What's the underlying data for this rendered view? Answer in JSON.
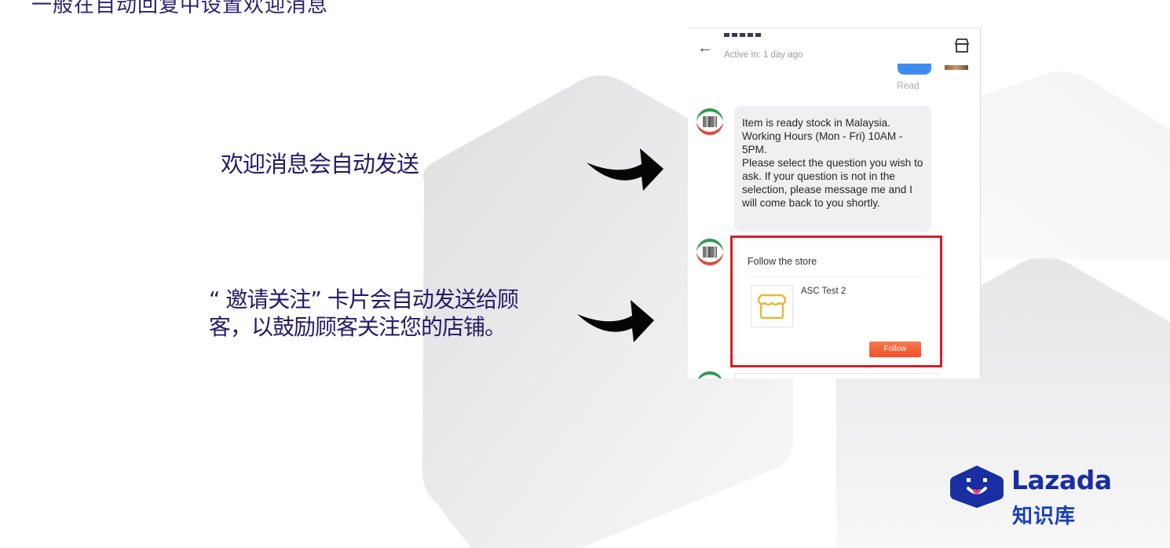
{
  "top_text": "一般在自动回复中设置欢迎消息",
  "captions": {
    "welcome": "欢迎消息会自动发送",
    "invite": "“ 邀请关注” 卡片会自动发送给顾 客，以鼓励顾客关注您的店铺。"
  },
  "phone": {
    "active_status": "Active in: 1 day ago",
    "read_label": "Read",
    "welcome_message": "Item is ready stock in Malaysia.\nWorking Hours (Mon - Fri) 10AM - 5PM.\nPlease select the question you wish to ask. If your question is not in the selection, please message me and I will come back to you shortly.",
    "follow_card": {
      "title": "Follow the store",
      "shop_name": "ASC Test 2",
      "follow_button": "Follow"
    },
    "icons": [
      "back-arrow-icon",
      "store-icon",
      "shop-placeholder-icon"
    ]
  },
  "logo": {
    "brand": "Lazada",
    "subtitle": "知识库",
    "colors": {
      "primary": "#1a2ea4",
      "accent": "#f23e6b"
    }
  },
  "colors": {
    "caption_text": "#231a6a",
    "highlight_border": "#d91e25",
    "follow_button": "#ef4f2a",
    "sent_bubble": "#3f8cf0"
  }
}
